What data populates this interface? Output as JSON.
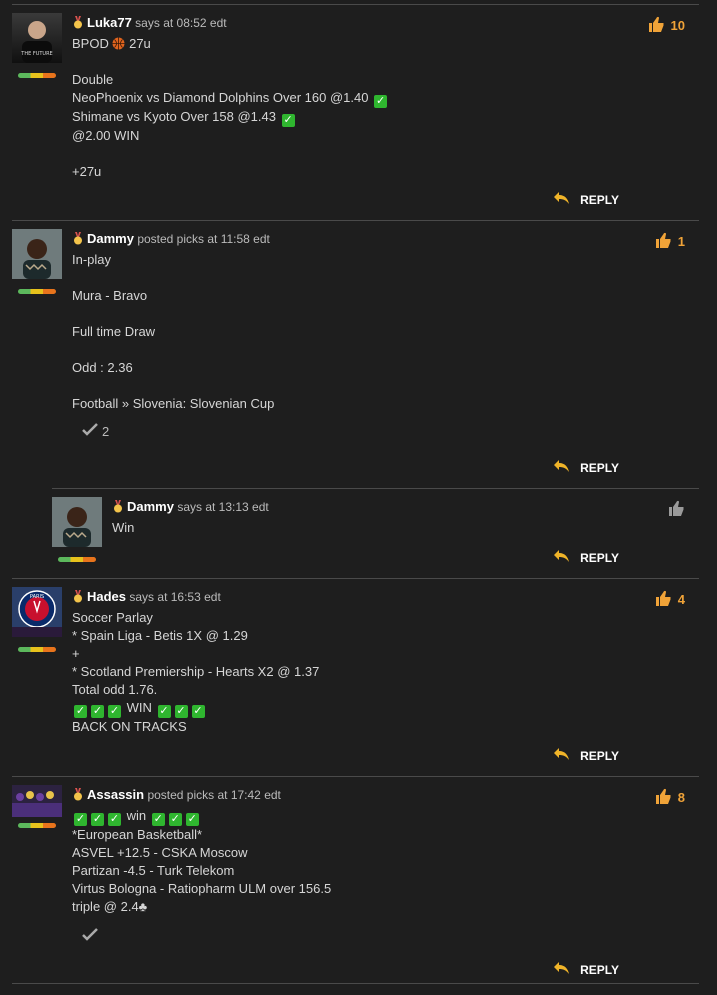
{
  "posts": [
    {
      "username": "Luka77",
      "verb": "says",
      "time": "at 08:52 edt",
      "likes": "10",
      "lines": [
        "BPOD",
        "Double",
        "NeoPhoenix vs Diamond Dolphins Over 160 @1.40",
        "Shimane vs Kyoto Over 158 @1.43",
        "@2.00 WIN",
        "+27u"
      ],
      "bpod_suffix": "27u",
      "reply": "REPLY"
    },
    {
      "username": "Dammy",
      "verb": "posted picks",
      "time": "at 11:58 edt",
      "likes": "1",
      "lines": [
        "In-play",
        "Mura - Bravo",
        "Full time Draw",
        "Odd : 2.36",
        "Football » Slovenia: Slovenian Cup"
      ],
      "confirm_count": "2",
      "reply": "REPLY"
    },
    {
      "username": "Dammy",
      "verb": "says",
      "time": "at 13:13 edt",
      "lines": [
        "Win"
      ],
      "reply": "REPLY"
    },
    {
      "username": "Hades",
      "verb": "says",
      "time": "at 16:53 edt",
      "likes": "4",
      "lines": [
        "Soccer Parlay",
        "* Spain Liga - Betis 1X @ 1.29",
        "+",
        "* Scotland Premiership - Hearts X2 @ 1.37",
        "Total odd 1.76.",
        "WIN",
        "BACK ON TRACKS"
      ],
      "reply": "REPLY"
    },
    {
      "username": "Assassin",
      "verb": "posted picks",
      "time": "at 17:42 edt",
      "likes": "8",
      "lines": [
        "win",
        "*European Basketball*",
        "ASVEL +12.5 - CSKA Moscow",
        "Partizan -4.5 - Turk Telekom",
        "Virtus Bologna - Ratiopharm ULM over 156.5",
        "triple @ 2.4♣"
      ],
      "reply": "REPLY"
    }
  ],
  "colors": {
    "accent": "#f0a338",
    "check": "#2fb62f",
    "bg": "#1e1e1e"
  }
}
